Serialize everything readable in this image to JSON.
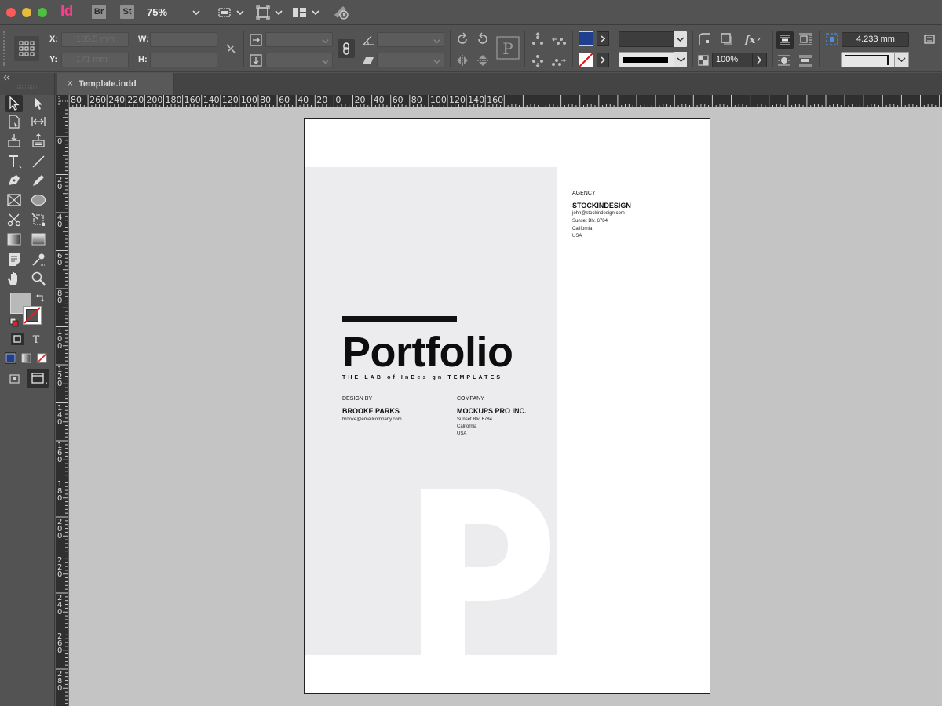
{
  "appbar": {
    "logo": "Id",
    "bridge": "Br",
    "stock": "St",
    "zoom": "75%"
  },
  "control": {
    "x_label": "X:",
    "y_label": "Y:",
    "w_label": "W:",
    "h_label": "H:",
    "x_value": "105.5 mm",
    "y_value": "171 mm",
    "opacity": "100%",
    "spacing": "4.233 mm",
    "fill_color": "#1f3f8f",
    "accent_pink": "#ff3b8e"
  },
  "document": {
    "tab_close": "×",
    "tab_name": "Template.indd"
  },
  "ruler_h": [
    "80",
    "260",
    "240",
    "220",
    "200",
    "180",
    "160",
    "140",
    "120",
    "100",
    "80",
    "60",
    "40",
    "20",
    "0",
    "20",
    "40",
    "60",
    "80",
    "100",
    "120",
    "140",
    "160"
  ],
  "ruler_v": [
    "0",
    "20",
    "40",
    "60",
    "80",
    "100",
    "120",
    "140",
    "160",
    "180",
    "200",
    "220",
    "240",
    "260",
    "280"
  ],
  "page": {
    "agency_label": "AGENCY",
    "agency_name": "STOCKINDESIGN",
    "agency_email": "john@stockindesign.com",
    "agency_street": "Sunset Blv. 6784",
    "agency_city": "California",
    "agency_country": "USA",
    "title": "Portfolio",
    "subtitle": "THE LAB of InDesign TEMPLATES",
    "design_label": "DESIGN BY",
    "designer": "BROOKE PARKS",
    "designer_email": "brooke@emailcompany.com",
    "company_label": "COMPANY",
    "company": "MOCKUPS PRO INC.",
    "company_street": "Sunset Blv. 6784",
    "company_city": "California",
    "company_country": "USA",
    "big_letter": "P"
  }
}
